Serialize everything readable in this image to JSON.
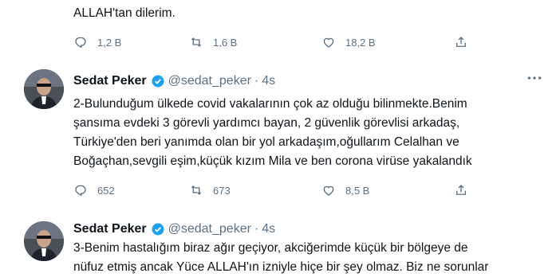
{
  "tweets": [
    {
      "text": "ALLAH'tan dilerim.",
      "replies": "1,2 B",
      "retweets": "1,6 B",
      "likes": "18,2 B"
    },
    {
      "name": "Sedat Peker",
      "handle": "@sedat_peker",
      "separator": "·",
      "time": "4s",
      "text": "2-Bulunduğum ülkede covid vakalarının çok az olduğu bilinmekte.Benim\nşansıma evdeki 3 görevli yardımcı bayan, 2 güvenlik görevlisi arkadaş,\nTürkiye'den beri yanımda olan bir yol arkadaşım,oğullarım Celalhan ve\nBoğaçhan,sevgili eşim,küçük kızım Mila ve ben corona virüse yakalandık",
      "replies": "652",
      "retweets": "673",
      "likes": "8,5 B"
    },
    {
      "name": "Sedat Peker",
      "handle": "@sedat_peker",
      "separator": "·",
      "time": "4s",
      "text": "3-Benim hastalığım biraz ağır geçiyor, akciğerimde küçük bir bölgeye de\nnüfuz etmiş ancak Yüce ALLAH'ın izniyle hiçe bir şey olmaz. Biz ne sorunlar"
    }
  ],
  "colors": {
    "verified": "#1da1f2",
    "muted": "#5b7083",
    "divider": "#e6ecf0"
  },
  "icons": {
    "reply": "reply-icon",
    "retweet": "retweet-icon",
    "like": "heart-icon",
    "share": "share-icon",
    "more": "more-icon",
    "verified": "verified-badge-icon"
  }
}
